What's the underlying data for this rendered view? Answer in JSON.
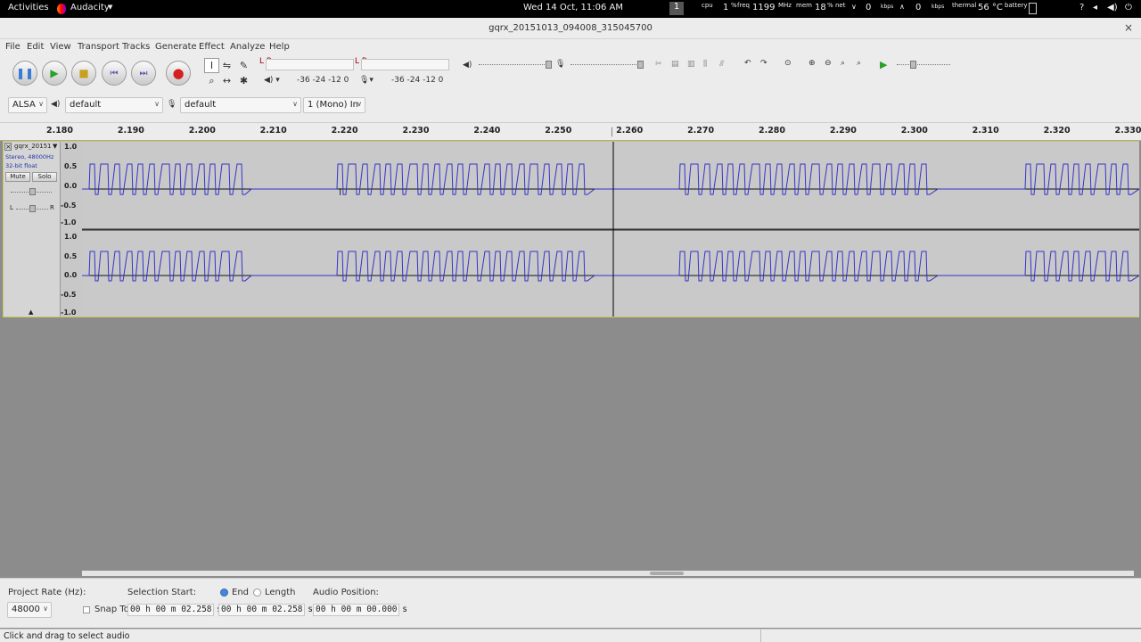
{
  "topbar": {
    "activities": "Activities",
    "app_name": "Audacity",
    "clock": "Wed 14 Oct, 11:06 AM",
    "workspace": "1",
    "cpu_label": "cpu",
    "cpu_value": "1",
    "freq_label": "freq",
    "freq_value": "1199",
    "freq_unit": "MHz",
    "mem_label": "mem",
    "mem_value": "18",
    "net_label": "net",
    "net_down": "0",
    "net_up": "0",
    "net_unit": "kbps",
    "thermal_label": "thermal",
    "thermal_value": "56 °C",
    "battery_label": "battery"
  },
  "window": {
    "title": "gqrx_20151013_094008_315045700"
  },
  "menu": [
    "File",
    "Edit",
    "View",
    "Transport",
    "Tracks",
    "Generate",
    "Effect",
    "Analyze",
    "Help"
  ],
  "meters": {
    "rec_lr": "L R",
    "play_lr": "L R",
    "rec_scale": "-36 -24 -12 0",
    "play_scale": "-36 -24 -12 0"
  },
  "devices": {
    "host": "ALSA",
    "output_device": "default",
    "input_device": "default",
    "channels": "1 (Mono) In"
  },
  "ruler": {
    "ticks": [
      "2.180",
      "2.190",
      "2.200",
      "2.210",
      "2.220",
      "2.230",
      "2.240",
      "2.250",
      "2.260",
      "2.270",
      "2.280",
      "2.290",
      "2.300",
      "2.310",
      "2.320",
      "2.330"
    ]
  },
  "track": {
    "name": "gqrx_20151",
    "info_line1": "Stereo, 48000Hz",
    "info_line2": "32-bit float",
    "mute": "Mute",
    "solo": "Solo",
    "pan_l": "L",
    "pan_r": "R",
    "scale": [
      "1.0",
      "0.5",
      "0.0",
      "-0.5",
      "-1.0"
    ]
  },
  "selection_bar": {
    "project_rate_label": "Project Rate (Hz):",
    "project_rate": "48000",
    "snap_to": "Snap To",
    "selection_start_label": "Selection Start:",
    "end_label": "End",
    "length_label": "Length",
    "start_time": "00 h 00 m 02.258 s",
    "end_time": "00 h 00 m 02.258 s",
    "audio_position_label": "Audio Position:",
    "audio_position": "00 h 00 m 00.000 s"
  },
  "status": {
    "text": "Click and drag to select audio"
  },
  "colors": {
    "waveform": "#3333cc",
    "cursor": "#000000",
    "track_border": "#c9c95a"
  }
}
